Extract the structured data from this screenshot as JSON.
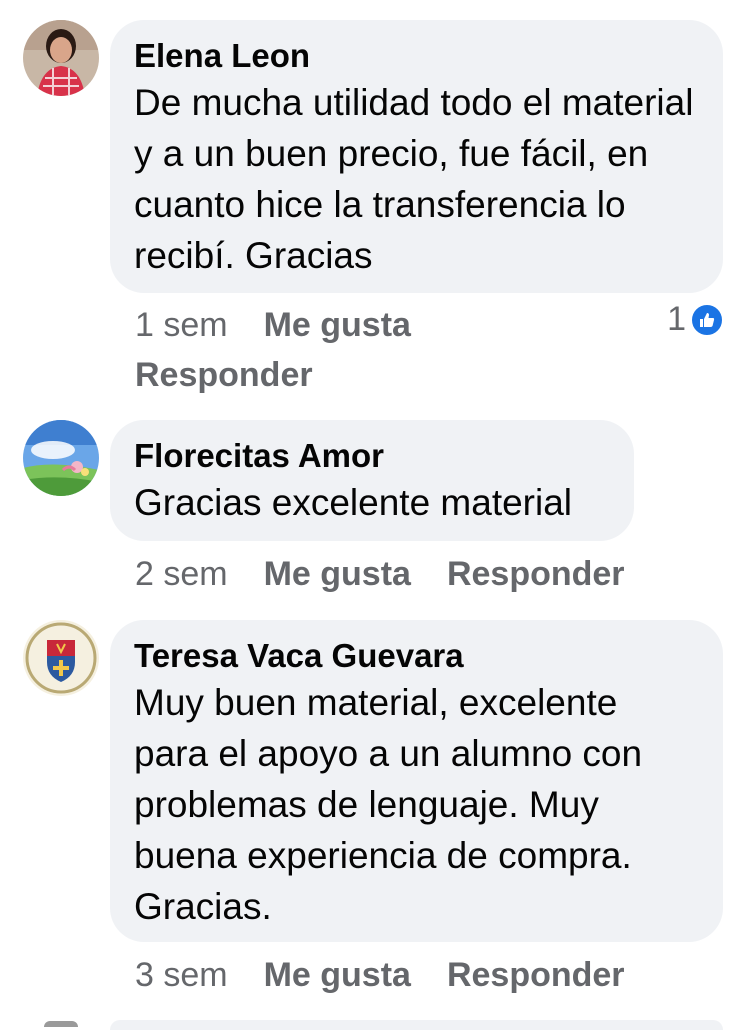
{
  "comments": [
    {
      "author": "Elena Leon",
      "text": "De mucha utilidad todo el material y a un buen precio, fue fácil, en cuanto hice la transferencia lo recibí. Gracias",
      "time": "1 sem",
      "like_label": "Me gusta",
      "reply_label": "Responder",
      "reaction_count": "1",
      "reaction_icon": "thumbs-up-icon",
      "avatar": "user-photo-avatar"
    },
    {
      "author": "Florecitas Amor",
      "text": "Gracias excelente material",
      "time": "2 sem",
      "like_label": "Me gusta",
      "reply_label": "Responder",
      "avatar": "landscape-avatar"
    },
    {
      "author": "Teresa Vaca Guevara",
      "text": "Muy buen material, excelente para el apoyo a un alumno con problemas de lenguaje. Muy buena experiencia de compra. Gracias.",
      "time": "3 sem",
      "like_label": "Me gusta",
      "reply_label": "Responder",
      "avatar": "school-crest-avatar"
    }
  ],
  "colors": {
    "bubble": "#f0f2f5",
    "secondary_text": "#65676b",
    "like_blue": "#1b74e4"
  }
}
